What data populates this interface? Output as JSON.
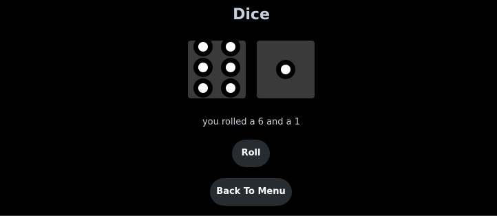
{
  "title": "Dice",
  "dice": [
    {
      "value": 6
    },
    {
      "value": 1
    }
  ],
  "result_text": "you rolled a 6 and a 1",
  "buttons": {
    "roll": "Roll",
    "back": "Back To Menu"
  },
  "colors": {
    "background": "#000000",
    "die_face": "#3a3a3a",
    "pip": "#ffffff",
    "button": "#272c31",
    "text": "#c6cfdb"
  }
}
